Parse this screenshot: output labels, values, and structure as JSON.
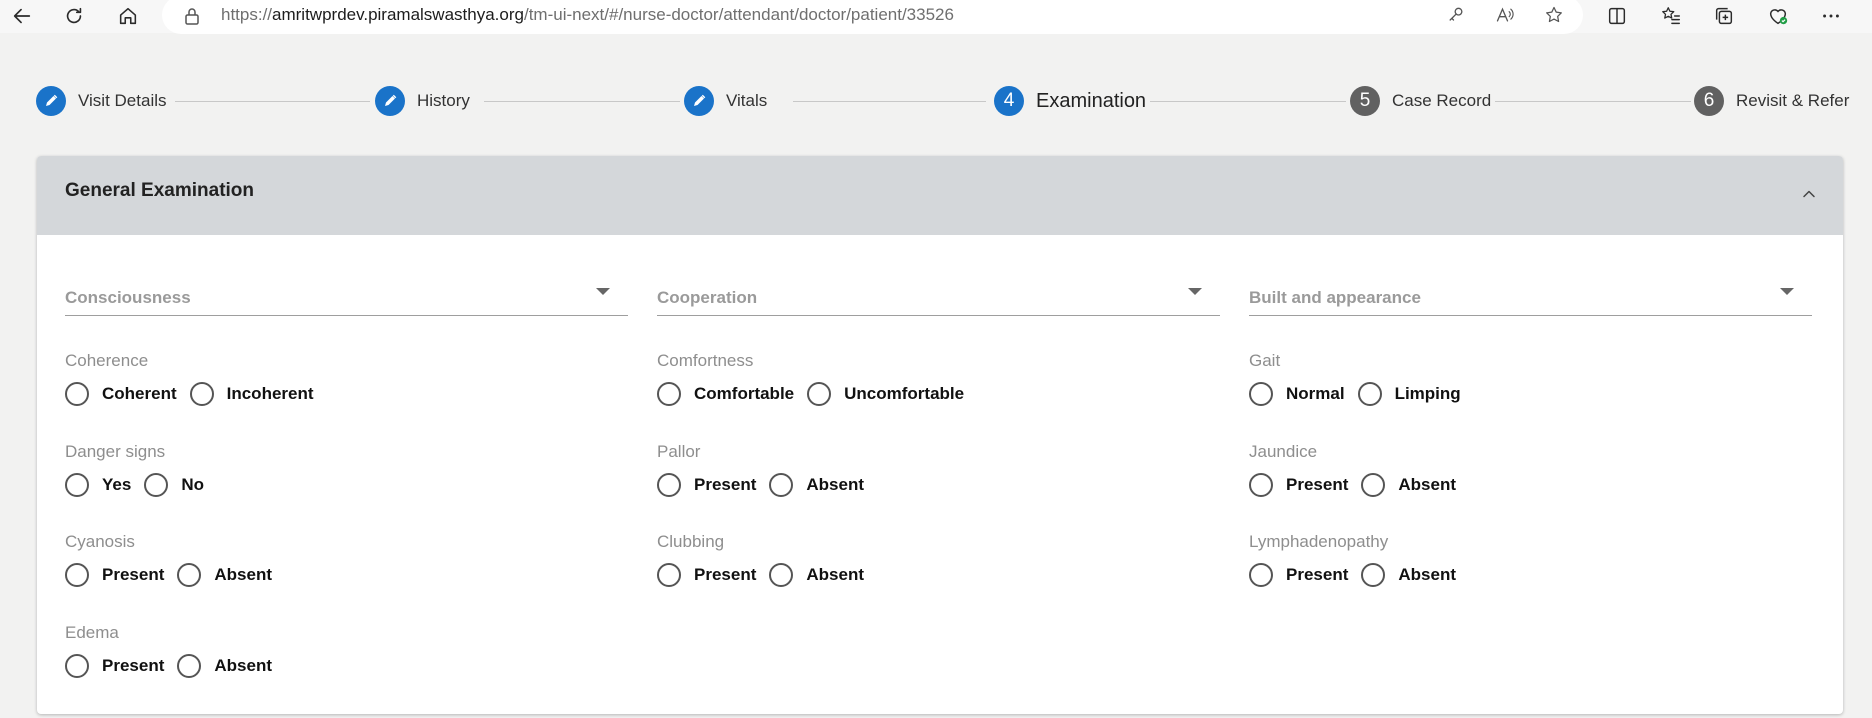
{
  "browser": {
    "url_host_prefix": "https://",
    "url_host": "amritwprdev.piramalswasthya.org",
    "url_path": "/tm-ui-next/#/nurse-doctor/attendant/doctor/patient/33526"
  },
  "stepper": {
    "steps": [
      {
        "label": "Visit Details",
        "number": "",
        "state": "done"
      },
      {
        "label": "History",
        "number": "",
        "state": "done"
      },
      {
        "label": "Vitals",
        "number": "",
        "state": "done"
      },
      {
        "label": "Examination",
        "number": "4",
        "state": "active"
      },
      {
        "label": "Case Record",
        "number": "5",
        "state": "todo"
      },
      {
        "label": "Revisit & Refer",
        "number": "6",
        "state": "todo"
      }
    ]
  },
  "section": {
    "title": "General Examination",
    "selects": [
      {
        "placeholder": "Consciousness"
      },
      {
        "placeholder": "Cooperation"
      },
      {
        "placeholder": "Built and appearance"
      }
    ],
    "groups": [
      {
        "label": "Coherence",
        "options": [
          "Coherent",
          "Incoherent"
        ]
      },
      {
        "label": "Comfortness",
        "options": [
          "Comfortable",
          "Uncomfortable"
        ]
      },
      {
        "label": "Gait",
        "options": [
          "Normal",
          "Limping"
        ]
      },
      {
        "label": "Danger signs",
        "options": [
          "Yes",
          "No"
        ]
      },
      {
        "label": "Pallor",
        "options": [
          "Present",
          "Absent"
        ]
      },
      {
        "label": "Jaundice",
        "options": [
          "Present",
          "Absent"
        ]
      },
      {
        "label": "Cyanosis",
        "options": [
          "Present",
          "Absent"
        ]
      },
      {
        "label": "Clubbing",
        "options": [
          "Present",
          "Absent"
        ]
      },
      {
        "label": "Lymphadenopathy",
        "options": [
          "Present",
          "Absent"
        ]
      },
      {
        "label": "Edema",
        "options": [
          "Present",
          "Absent"
        ]
      }
    ]
  },
  "colors": {
    "accent": "#1a73c9",
    "step_pending": "#616161",
    "header_bg": "#d4d7da"
  }
}
